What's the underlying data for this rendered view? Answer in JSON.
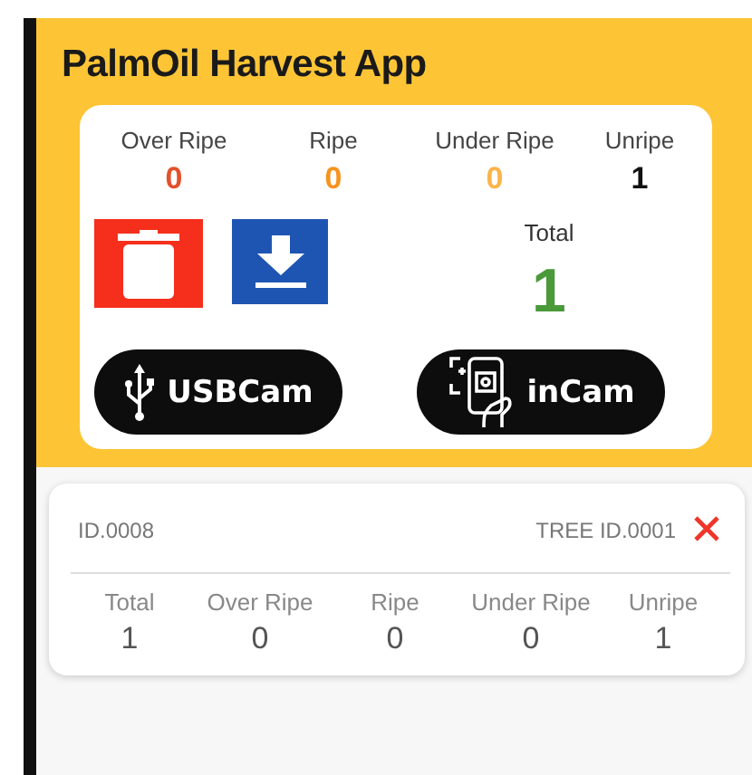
{
  "app_title": "PalmOil Harvest App",
  "counts": [
    {
      "label": "Over Ripe",
      "value": "0",
      "color": "#e4502a"
    },
    {
      "label": "Ripe",
      "value": "0",
      "color": "#f7931e"
    },
    {
      "label": "Under Ripe",
      "value": "0",
      "color": "#fbb44a"
    },
    {
      "label": "Unripe",
      "value": "1",
      "color": "#111111"
    }
  ],
  "total": {
    "label": "Total",
    "value": "1"
  },
  "camera_buttons": [
    {
      "label": "USBCam",
      "kind": "usb"
    },
    {
      "label": "inCam",
      "kind": "phone"
    }
  ],
  "records": [
    {
      "id": "ID.0008",
      "tree_id": "TREE ID.0001",
      "stats": [
        {
          "label": "Total",
          "value": "1"
        },
        {
          "label": "Over Ripe",
          "value": "0"
        },
        {
          "label": "Ripe",
          "value": "0"
        },
        {
          "label": "Under Ripe",
          "value": "0"
        },
        {
          "label": "Unripe",
          "value": "1"
        }
      ]
    }
  ]
}
